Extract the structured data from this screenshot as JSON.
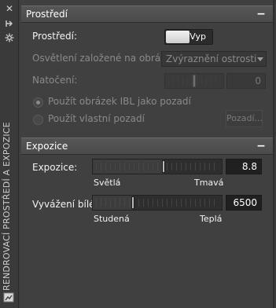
{
  "palette": {
    "title": "RENDROVACÍ PROSTŘEDÍ A EXPOZICE",
    "close_icon": "✕",
    "autohide_icon": "pin-icon",
    "properties_icon": "gear-icon"
  },
  "environment": {
    "header": "Prostředí",
    "collapse_label": "−",
    "env_label": "Prostředí:",
    "env_toggle": {
      "state": "off",
      "label": "Vyp"
    },
    "ibl_label": "Osvětlení založené na obrázku:",
    "ibl_value": "Zvýraznění ostrosti",
    "rotation_label": "Natočení:",
    "rotation_value": "0",
    "rotation_fraction": 0.5,
    "radio_ibl_bg": "Použít obrázek IBL jako pozadí",
    "radio_custom_bg": "Použít vlastní pozadí",
    "bg_button": "Pozadí..."
  },
  "exposure": {
    "header": "Expozice",
    "collapse_label": "−",
    "exposure_label": "Expozice:",
    "exposure_value": "8.8",
    "exposure_fraction": 0.55,
    "exposure_min_label": "Světlá",
    "exposure_max_label": "Tmavá",
    "wb_label": "Vyvážení bílé:",
    "wb_value": "6500",
    "wb_fraction": 0.31,
    "wb_min_label": "Studená",
    "wb_max_label": "Teplá"
  },
  "colors": {
    "panel_bg": "#404040",
    "header_bg": "#4f4f4f",
    "text": "#f2f2f2",
    "disabled_text": "#8a8a8a"
  }
}
